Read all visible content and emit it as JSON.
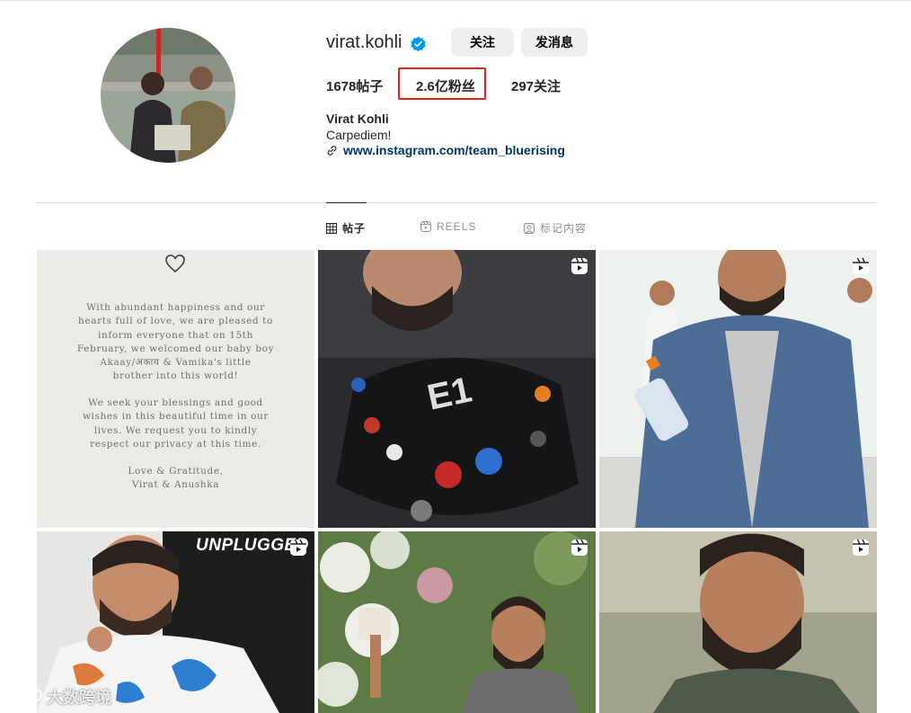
{
  "profile": {
    "username": "virat.kohli",
    "verified": true,
    "follow_label": "关注",
    "message_label": "发消息",
    "stats": {
      "posts": "1678帖子",
      "followers": "2.6亿粉丝",
      "following": "297关注"
    },
    "full_name": "Virat Kohli",
    "bio": "Carpediem!",
    "link": "www.instagram.com/team_bluerising"
  },
  "tabs": [
    {
      "label": "帖子",
      "icon": "grid-icon",
      "active": true
    },
    {
      "label": "REELS",
      "icon": "reels-icon",
      "active": false
    },
    {
      "label": "标记内容",
      "icon": "tagged-icon",
      "active": false
    }
  ],
  "posts": {
    "announcement": {
      "paragraph1": "With abundant happiness and our\nhearts full of love, we are pleased to\ninform everyone that on 15th\nFebruary, we welcomed our baby boy\nAkaay/अकाय & Vamika's little\nbrother into this world!",
      "paragraph2": "We seek your blessings and good\nwishes in this beautiful time in our\nlives. We request you to kindly\nrespect our privacy at this time.",
      "signature": "Love & Gratitude,\nVirat & Anushka"
    },
    "e1_badge": "E1",
    "unplugged_text": "UNPLUGGED"
  },
  "watermark": "大数跨境",
  "colors": {
    "verified_blue": "#0095f6",
    "link_blue": "#00376b",
    "highlight_red": "#e0231f",
    "button_gray": "#efefef"
  }
}
